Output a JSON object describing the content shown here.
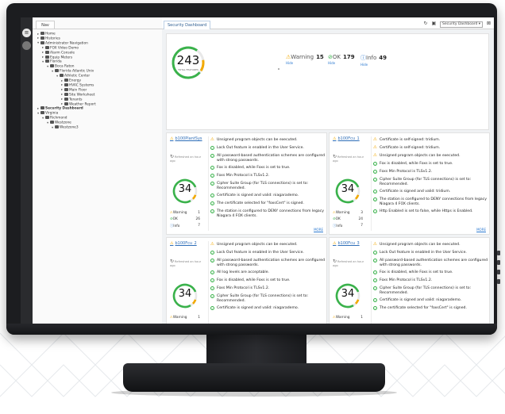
{
  "nav": {
    "tab_label": "Nav",
    "tree": [
      {
        "label": "Home",
        "depth": 0,
        "arrow": "▸"
      },
      {
        "label": "Histories",
        "depth": 0,
        "arrow": "▸"
      },
      {
        "label": "Administrator Navigation",
        "depth": 0,
        "arrow": "▾"
      },
      {
        "label": "FOX Video Demo",
        "depth": 1,
        "arrow": "▸"
      },
      {
        "label": "Alarm Console",
        "depth": 1,
        "arrow": "▸"
      },
      {
        "label": "Equip Meters",
        "depth": 1,
        "arrow": "▸"
      },
      {
        "label": "Florida",
        "depth": 1,
        "arrow": "▾"
      },
      {
        "label": "Boca Raton",
        "depth": 2,
        "arrow": "▾"
      },
      {
        "label": "Florida Atlantic Univ",
        "depth": 3,
        "arrow": "▾"
      },
      {
        "label": "Athletic Center",
        "depth": 4,
        "arrow": "▾"
      },
      {
        "label": "Energy",
        "depth": 5,
        "arrow": "▸"
      },
      {
        "label": "HVAC Systems",
        "depth": 5,
        "arrow": "▸"
      },
      {
        "label": "Main Floor",
        "depth": 5,
        "arrow": "▸"
      },
      {
        "label": "Site Worksheet",
        "depth": 5,
        "arrow": "▸"
      },
      {
        "label": "Tenants",
        "depth": 5,
        "arrow": "▸"
      },
      {
        "label": "Weather Report",
        "depth": 5,
        "arrow": "▸"
      },
      {
        "label": "Security Dashboard",
        "depth": 0,
        "arrow": "▸",
        "bold": true
      },
      {
        "label": "Virginia",
        "depth": 0,
        "arrow": "▾"
      },
      {
        "label": "Richmond",
        "depth": 1,
        "arrow": "▾"
      },
      {
        "label": "Westzone",
        "depth": 2,
        "arrow": "▾"
      },
      {
        "label": "Westzone3",
        "depth": 3,
        "arrow": "▾"
      }
    ]
  },
  "topbar": {
    "tab_label": "Security Dashboard",
    "view_select": "Security Dashboard ▾"
  },
  "summary": {
    "total": "243",
    "total_label": "TOTAL FEATURES",
    "warning_label": "Warning",
    "warning_count": "15",
    "ok_label": "OK",
    "ok_count": "179",
    "info_label": "Info",
    "info_count": "49",
    "hide_label": "Hide"
  },
  "colors": {
    "warning": "#f2a900",
    "ok": "#3ab24b",
    "info": "#2e7bd1",
    "link": "#2e6eb8"
  },
  "cards": [
    {
      "title": "b100PlantSys",
      "refresh": "Refreshed an hour ago",
      "score": "34",
      "counts": [
        {
          "label": "Warning",
          "value": "1"
        },
        {
          "label": "OK",
          "value": "26"
        },
        {
          "label": "Info",
          "value": "7"
        }
      ],
      "issues": [
        {
          "type": "warning",
          "text": "Unsigned program objects can be executed."
        },
        {
          "type": "ok",
          "text": "Lock Out feature is enabled in the User Service."
        },
        {
          "type": "ok",
          "text": "All password-based authentication schemes are configured with strong passwords."
        },
        {
          "type": "ok",
          "text": "Fox is disabled, while Foxs is set to true."
        },
        {
          "type": "ok",
          "text": "Foxs Min Protocol is TLSv1.2."
        },
        {
          "type": "ok",
          "text": "Cipher Suite Group (for TLS connections) is set to: Recommended."
        },
        {
          "type": "ok",
          "text": "Certificate is signed and valid: niagarademo."
        },
        {
          "type": "ok",
          "text": "The certificate selected for \"foxsCert\" is signed."
        },
        {
          "type": "ok",
          "text": "The station is configured to DENY connections from legacy Niagara 4 FOX clients."
        }
      ],
      "more": "MORE"
    },
    {
      "title": "b100Fcu_1",
      "refresh": "Refreshed an hour ago",
      "score": "34",
      "counts": [
        {
          "label": "Warning",
          "value": "3"
        },
        {
          "label": "OK",
          "value": "24"
        },
        {
          "label": "Info",
          "value": "7"
        }
      ],
      "issues": [
        {
          "type": "warning",
          "text": "Certificate is self-signed: tridium."
        },
        {
          "type": "warning",
          "text": "Certificate is self-signed: tridium."
        },
        {
          "type": "warning",
          "text": "Unsigned program objects can be executed."
        },
        {
          "type": "ok",
          "text": "Fox is disabled, while Foxs is set to true."
        },
        {
          "type": "ok",
          "text": "Foxs Min Protocol is TLSv1.2."
        },
        {
          "type": "ok",
          "text": "Cipher Suite Group (for TLS connections) is set to: Recommended."
        },
        {
          "type": "ok",
          "text": "Certificate is signed and valid: tridium."
        },
        {
          "type": "ok",
          "text": "The station is configured to DENY connections from legacy Niagara 4 FOX clients."
        },
        {
          "type": "ok",
          "text": "Http Enabled is set to false, while Https is Enabled."
        }
      ],
      "more": "MORE"
    },
    {
      "title": "b100Fcu_2",
      "refresh": "Refreshed an hour ago",
      "score": "34",
      "counts": [
        {
          "label": "Warning",
          "value": "1"
        }
      ],
      "issues": [
        {
          "type": "warning",
          "text": "Unsigned program objects can be executed."
        },
        {
          "type": "ok",
          "text": "Lock Out feature is enabled in the User Service."
        },
        {
          "type": "ok",
          "text": "All password-based authentication schemes are configured with strong passwords."
        },
        {
          "type": "ok",
          "text": "All log levels are acceptable."
        },
        {
          "type": "ok",
          "text": "Fox is disabled, while Foxs is set to true."
        },
        {
          "type": "ok",
          "text": "Foxs Min Protocol is TLSv1.2."
        },
        {
          "type": "ok",
          "text": "Cipher Suite Group (for TLS connections) is set to: Recommended."
        },
        {
          "type": "ok",
          "text": "Certificate is signed and valid: niagarademo."
        }
      ]
    },
    {
      "title": "b100Fcu_3",
      "refresh": "Refreshed an hour ago",
      "score": "34",
      "counts": [
        {
          "label": "Warning",
          "value": "1"
        }
      ],
      "issues": [
        {
          "type": "warning",
          "text": "Unsigned program objects can be executed."
        },
        {
          "type": "ok",
          "text": "Lock Out feature is enabled in the User Service."
        },
        {
          "type": "ok",
          "text": "All password-based authentication schemes are configured with strong passwords."
        },
        {
          "type": "ok",
          "text": "Fox is disabled, while Foxs is set to true."
        },
        {
          "type": "ok",
          "text": "Foxs Min Protocol is TLSv1.2."
        },
        {
          "type": "ok",
          "text": "Cipher Suite Group (for TLS connections) is set to: Recommended."
        },
        {
          "type": "ok",
          "text": "Certificate is signed and valid: niagarademo."
        },
        {
          "type": "ok",
          "text": "The certificate selected for \"foxsCert\" is signed."
        }
      ]
    }
  ]
}
